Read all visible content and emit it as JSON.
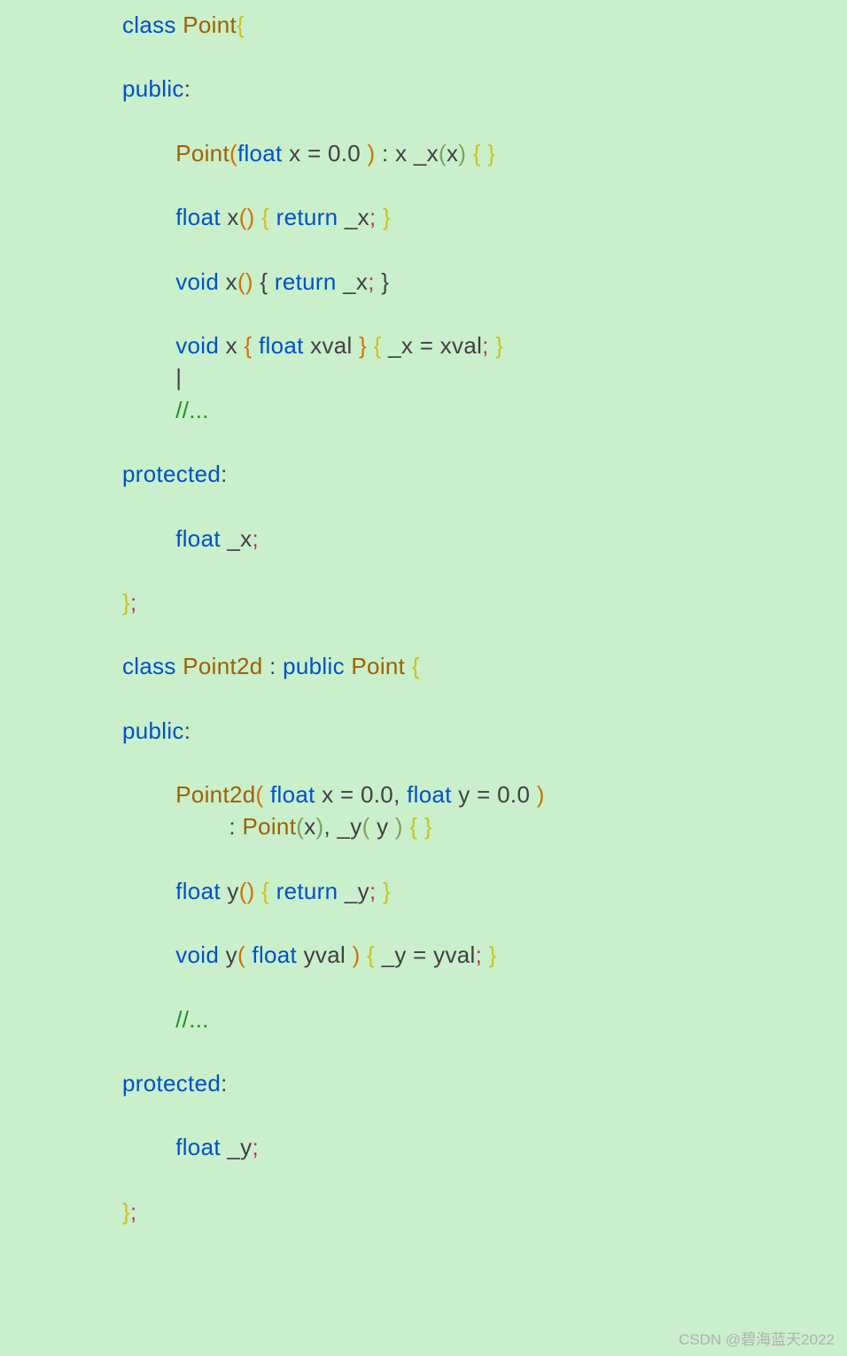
{
  "lines": {
    "l1_class": "class",
    "l1_name": "Point",
    "l1_brace": "{",
    "l2_public": "public",
    "l2_colon": ":",
    "l3_func": "Point",
    "l3_p1": "(",
    "l3_type": "float",
    "l3_x": " x ",
    "l3_eq": "= ",
    "l3_val": "0.0 ",
    "l3_p2": ")",
    "l3_colon": " : ",
    "l3_init": "x _x",
    "l3_p3": "(",
    "l3_arg": "x",
    "l3_p4": ")",
    "l3_b1": " { }",
    "l4_type": "float",
    "l4_x": " x",
    "l4_p1": "()",
    "l4_b1": " { ",
    "l4_ret": "return",
    "l4_var": " _x",
    "l4_semi": ";",
    "l4_b2": " }",
    "l5_type": "void",
    "l5_x": " x",
    "l5_p1": "()",
    "l5_b1": " { ",
    "l5_ret": "return",
    "l5_var": " _x",
    "l5_semi": ";",
    "l5_b2": " }",
    "l6_type": "void",
    "l6_x": " x ",
    "l6_b1": "{ ",
    "l6_ftype": "float",
    "l6_var": " xval ",
    "l6_b2": "}",
    "l6_b3": " { ",
    "l6_assign": "_x = xval",
    "l6_semi": ";",
    "l6_b4": " }",
    "cursor": "|",
    "l7_comment": "//...",
    "l8_prot": "protected",
    "l8_colon": ":",
    "l9_type": "float",
    "l9_var": " _x",
    "l9_semi": ";",
    "l10_brace": "}",
    "l10_semi": ";",
    "l11_class": "class",
    "l11_name": " Point2d ",
    "l11_colon": ": ",
    "l11_public": "public",
    "l11_base": " Point ",
    "l11_brace": "{",
    "l12_public": "public",
    "l12_colon": ":",
    "l13_func": "Point2d",
    "l13_p1": "( ",
    "l13_t1": "float",
    "l13_x": " x ",
    "l13_eq1": "= ",
    "l13_v1": "0.0",
    "l13_comma": ", ",
    "l13_t2": "float",
    "l13_y": " y ",
    "l13_eq2": "= ",
    "l13_v2": "0.0 ",
    "l13_p2": ")",
    "l13b_colon": ": ",
    "l13b_base": "Point",
    "l13b_p1": "(",
    "l13b_x": "x",
    "l13b_p2": ")",
    "l13b_comma": ", ",
    "l13b_init": "_y",
    "l13b_p3": "( ",
    "l13b_y": "y ",
    "l13b_p4": ")",
    "l13b_b": " { }",
    "l14_type": "float",
    "l14_y": " y",
    "l14_p1": "()",
    "l14_b1": " { ",
    "l14_ret": "return",
    "l14_var": " _y",
    "l14_semi": ";",
    "l14_b2": " }",
    "l15_type": "void",
    "l15_y": " y",
    "l15_p1": "( ",
    "l15_ftype": "float",
    "l15_var": " yval ",
    "l15_p2": ")",
    "l15_b1": " { ",
    "l15_assign": "_y = yval",
    "l15_semi": ";",
    "l15_b2": " }",
    "l16_comment": "//...",
    "l17_prot": "protected",
    "l17_colon": ":",
    "l18_type": "float",
    "l18_var": " _y",
    "l18_semi": ";",
    "l19_brace": "}",
    "l19_semi": ";"
  },
  "watermark": "CSDN @碧海蓝天2022"
}
